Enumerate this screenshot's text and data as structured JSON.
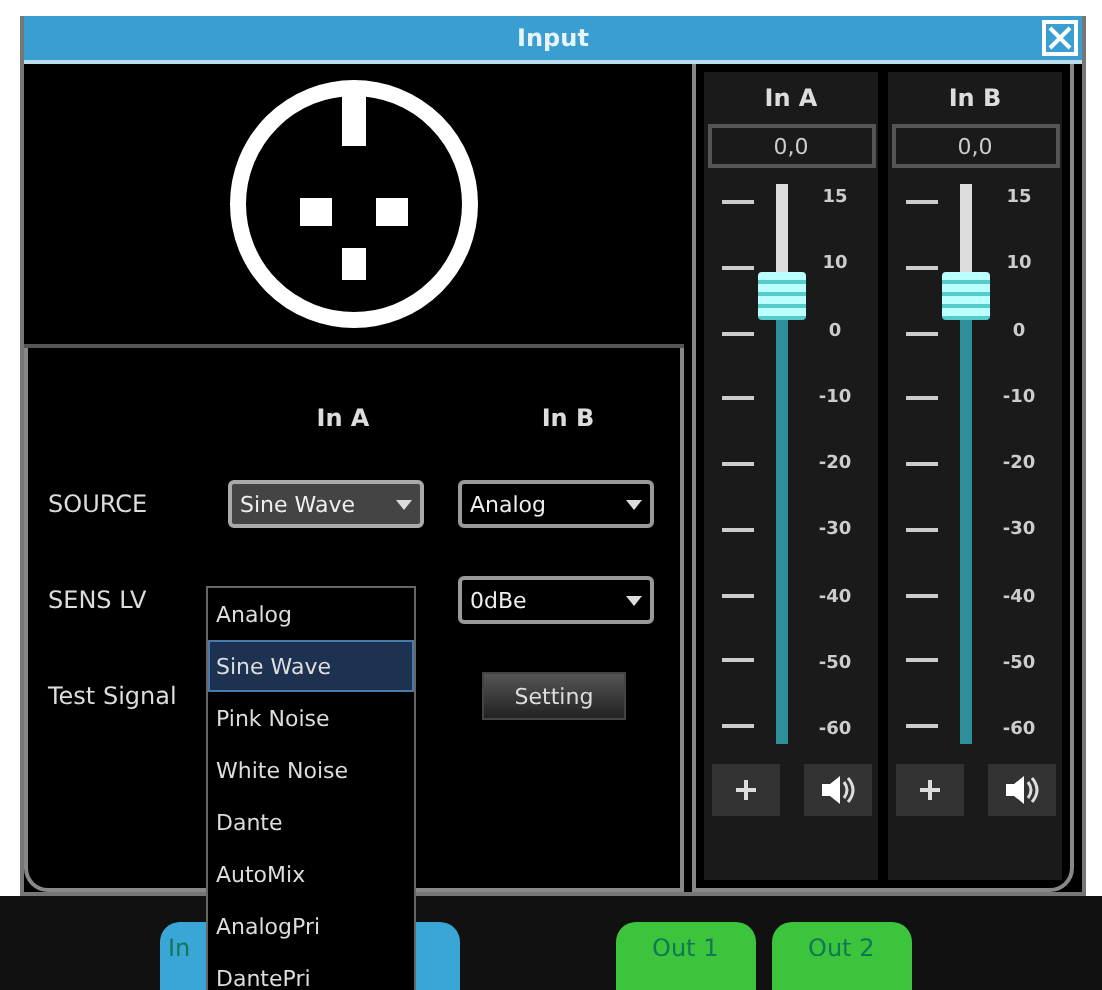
{
  "window": {
    "title": "Input"
  },
  "columns": [
    "In A",
    "In B"
  ],
  "rows": [
    {
      "label": "SOURCE",
      "kind": "select",
      "in_a": {
        "value": "Sine Wave",
        "expanded": true
      },
      "in_b": {
        "value": "Analog",
        "expanded": false
      }
    },
    {
      "label": "SENS LV",
      "kind": "select",
      "in_b": {
        "value": "0dBe",
        "expanded": false
      }
    },
    {
      "label": "Test Signal",
      "kind": "button",
      "in_b": {
        "value": "Setting"
      }
    }
  ],
  "dropdown": {
    "options": [
      {
        "label": "Analog",
        "selected": false
      },
      {
        "label": "Sine Wave",
        "selected": true
      },
      {
        "label": "Pink Noise",
        "selected": false
      },
      {
        "label": "White Noise",
        "selected": false
      },
      {
        "label": "Dante",
        "selected": false
      },
      {
        "label": "AutoMix",
        "selected": false
      },
      {
        "label": "AnalogPri",
        "selected": false
      },
      {
        "label": "DantePri",
        "selected": false
      }
    ]
  },
  "channels": [
    {
      "name": "In A",
      "reading": "0,0",
      "level": 0.8,
      "scale": [
        "15",
        "10",
        "0",
        "-10",
        "-20",
        "-30",
        "-40",
        "-50",
        "-60"
      ]
    },
    {
      "name": "In B",
      "reading": "0,0",
      "level": 0.8,
      "scale": [
        "15",
        "10",
        "0",
        "-10",
        "-20",
        "-30",
        "-40",
        "-50",
        "-60"
      ]
    }
  ],
  "bottom_tabs": [
    {
      "label": "In",
      "color": "#3aa6d6"
    },
    {
      "label": "Out 1",
      "color": "#3cc43c"
    },
    {
      "label": "Out 2",
      "color": "#3cc43c"
    }
  ]
}
